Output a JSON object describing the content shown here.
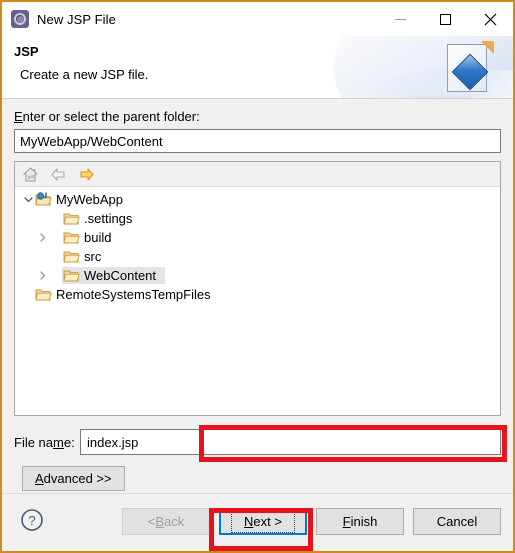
{
  "window": {
    "title": "New JSP File",
    "icon": "jsp-wizard-icon",
    "border_color": "#d08a1e",
    "controls": {
      "minimize": "minimize-icon",
      "maximize": "maximize-icon",
      "close": "close-icon"
    }
  },
  "header": {
    "title": "JSP",
    "subtitle": "Create a new JSP file.",
    "icon": "jsp-file-banner-icon"
  },
  "form": {
    "parent_folder_label_pre": "E",
    "parent_folder_label_post": "nter or select the parent folder:",
    "parent_folder_value": "MyWebApp/WebContent",
    "parent_folder_placeholder": "",
    "file_name_label_pre": "File na",
    "file_name_label_mid": "m",
    "file_name_label_post": "e:",
    "file_name_value": "index.jsp",
    "file_name_placeholder": "",
    "advanced_pre": "A",
    "advanced_post": "dvanced >>"
  },
  "tree": {
    "toolbar": [
      "home-icon",
      "back-arrow-icon",
      "forward-arrow-icon"
    ],
    "items": [
      {
        "label": "MyWebApp",
        "icon": "java-web-project-icon",
        "depth": 0,
        "twisty": "expanded",
        "selected": false
      },
      {
        "label": ".settings",
        "icon": "folder-icon",
        "depth": 1,
        "twisty": "none",
        "selected": false
      },
      {
        "label": "build",
        "icon": "folder-icon",
        "depth": 1,
        "twisty": "collapsed",
        "selected": false
      },
      {
        "label": "src",
        "icon": "folder-icon",
        "depth": 1,
        "twisty": "none",
        "selected": false
      },
      {
        "label": "WebContent",
        "icon": "folder-icon",
        "depth": 1,
        "twisty": "collapsed",
        "selected": true
      },
      {
        "label": "RemoteSystemsTempFiles",
        "icon": "folder-icon",
        "depth": 0,
        "twisty": "none",
        "selected": false
      }
    ]
  },
  "footer": {
    "help": "help-icon",
    "back_pre": "< ",
    "back_mid": "B",
    "back_post": "ack",
    "next_pre": "",
    "next_mid": "N",
    "next_post": "ext >",
    "finish_pre": "",
    "finish_mid": "F",
    "finish_post": "inish",
    "cancel": "Cancel"
  },
  "annotations": {
    "highlight_color": "#e8121a",
    "boxes": [
      "file-name-input",
      "next-button"
    ]
  }
}
